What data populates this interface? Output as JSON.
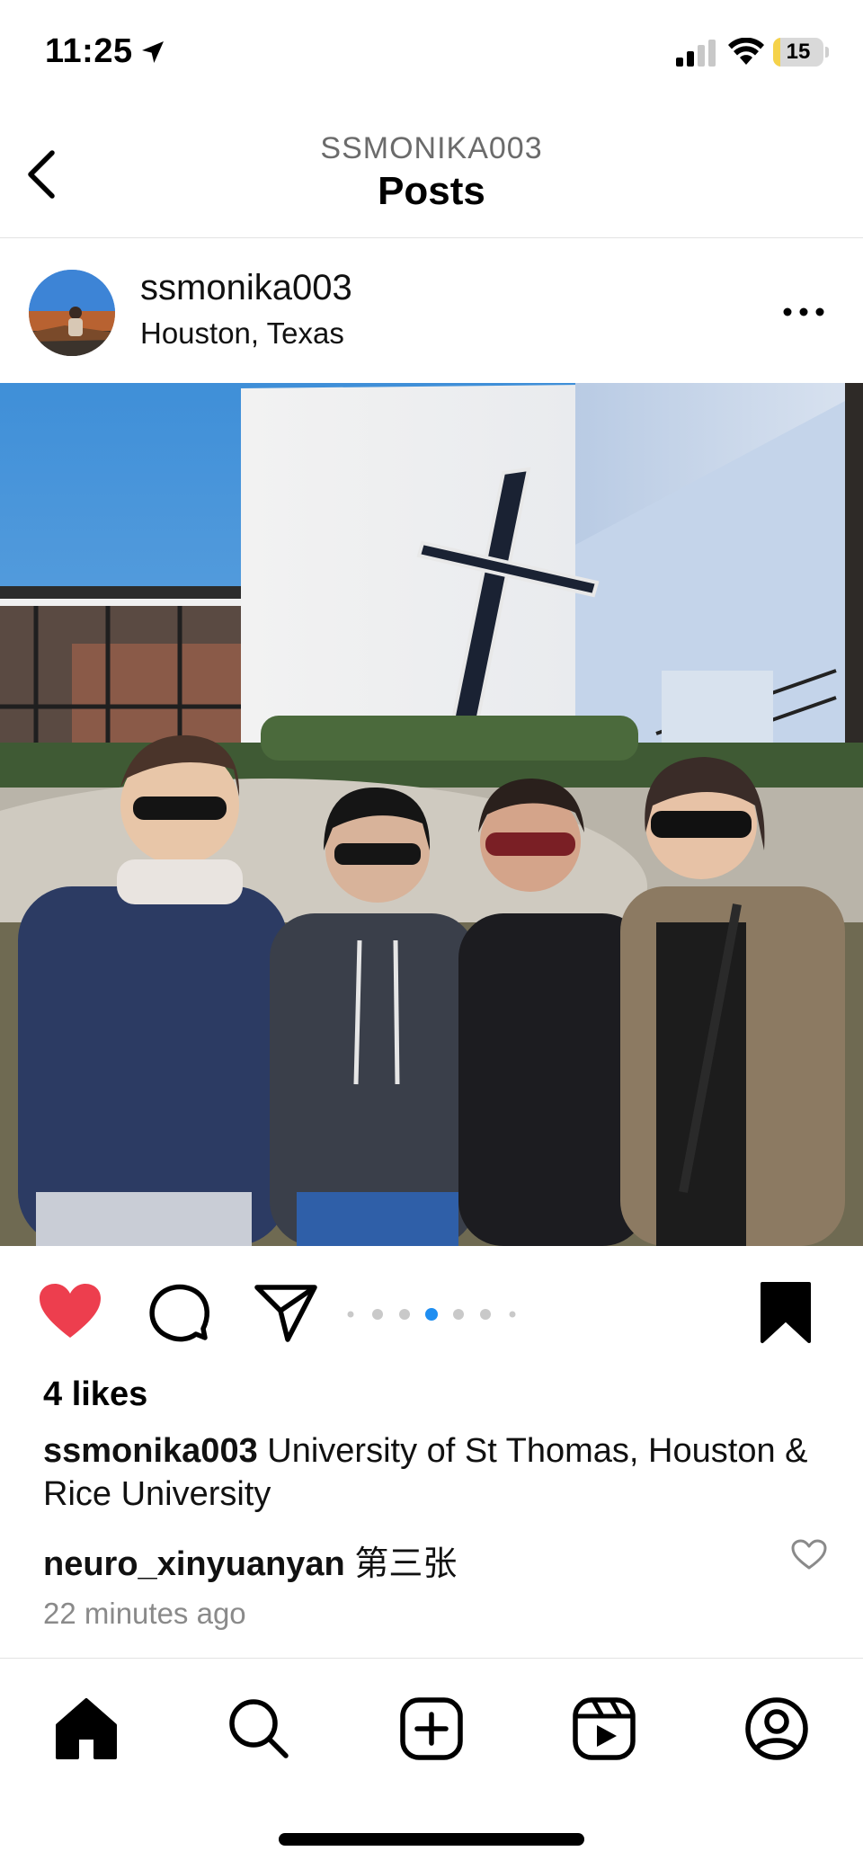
{
  "status_bar": {
    "time": "11:25",
    "battery_level": "15",
    "battery_fraction": 0.15,
    "battery_color": "#f5d24a",
    "icons": [
      "location-arrow-icon",
      "cellular-signal-icon",
      "wifi-icon",
      "battery-icon"
    ]
  },
  "header": {
    "account": "SSMONIKA003",
    "title": "Posts",
    "back_icon": "chevron-left-icon"
  },
  "post": {
    "username": "ssmonika003",
    "location": "Houston, Texas",
    "more_icon": "ellipsis-icon",
    "photo_subject": "four people in front of white chapel with cross",
    "liked": true,
    "like_color": "#ed3e4e",
    "carousel": {
      "total": 7,
      "active": 4,
      "active_color": "#1f8ef1"
    },
    "saved": true,
    "likes_text": "4 likes",
    "caption_user": "ssmonika003",
    "caption_text": " University of St Thomas, Houston & Rice University",
    "comment_user": "neuro_xinyuanyan",
    "comment_text": " 第三张",
    "time_ago": "22 minutes ago"
  },
  "tab_bar": {
    "items": [
      "home-icon",
      "search-icon",
      "create-post-icon",
      "reels-icon",
      "profile-icon"
    ],
    "active": "home-icon"
  }
}
